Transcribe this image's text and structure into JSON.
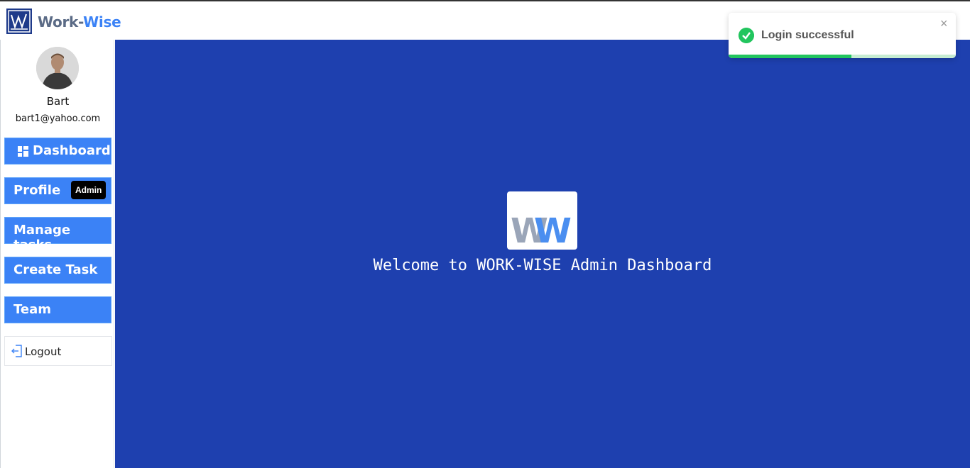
{
  "app": {
    "brand_part1": "Work-",
    "brand_part2": "Wise"
  },
  "user": {
    "name": "Bart",
    "email": "bart1@yahoo.com"
  },
  "sidebar": {
    "items": [
      {
        "label": "Dashboard",
        "icon": "dashboard-icon"
      },
      {
        "label": "Profile",
        "badge": "Admin"
      },
      {
        "label": "Manage tasks"
      },
      {
        "label": "Create Task"
      },
      {
        "label": "Team"
      }
    ],
    "logout_label": "Logout"
  },
  "main": {
    "welcome_text": "Welcome to WORK-WISE Admin Dashboard",
    "background_color": "#1e40af"
  },
  "toast": {
    "message": "Login successful",
    "close_symbol": "×",
    "progress": 0.54,
    "accent_color": "#22c55e"
  }
}
